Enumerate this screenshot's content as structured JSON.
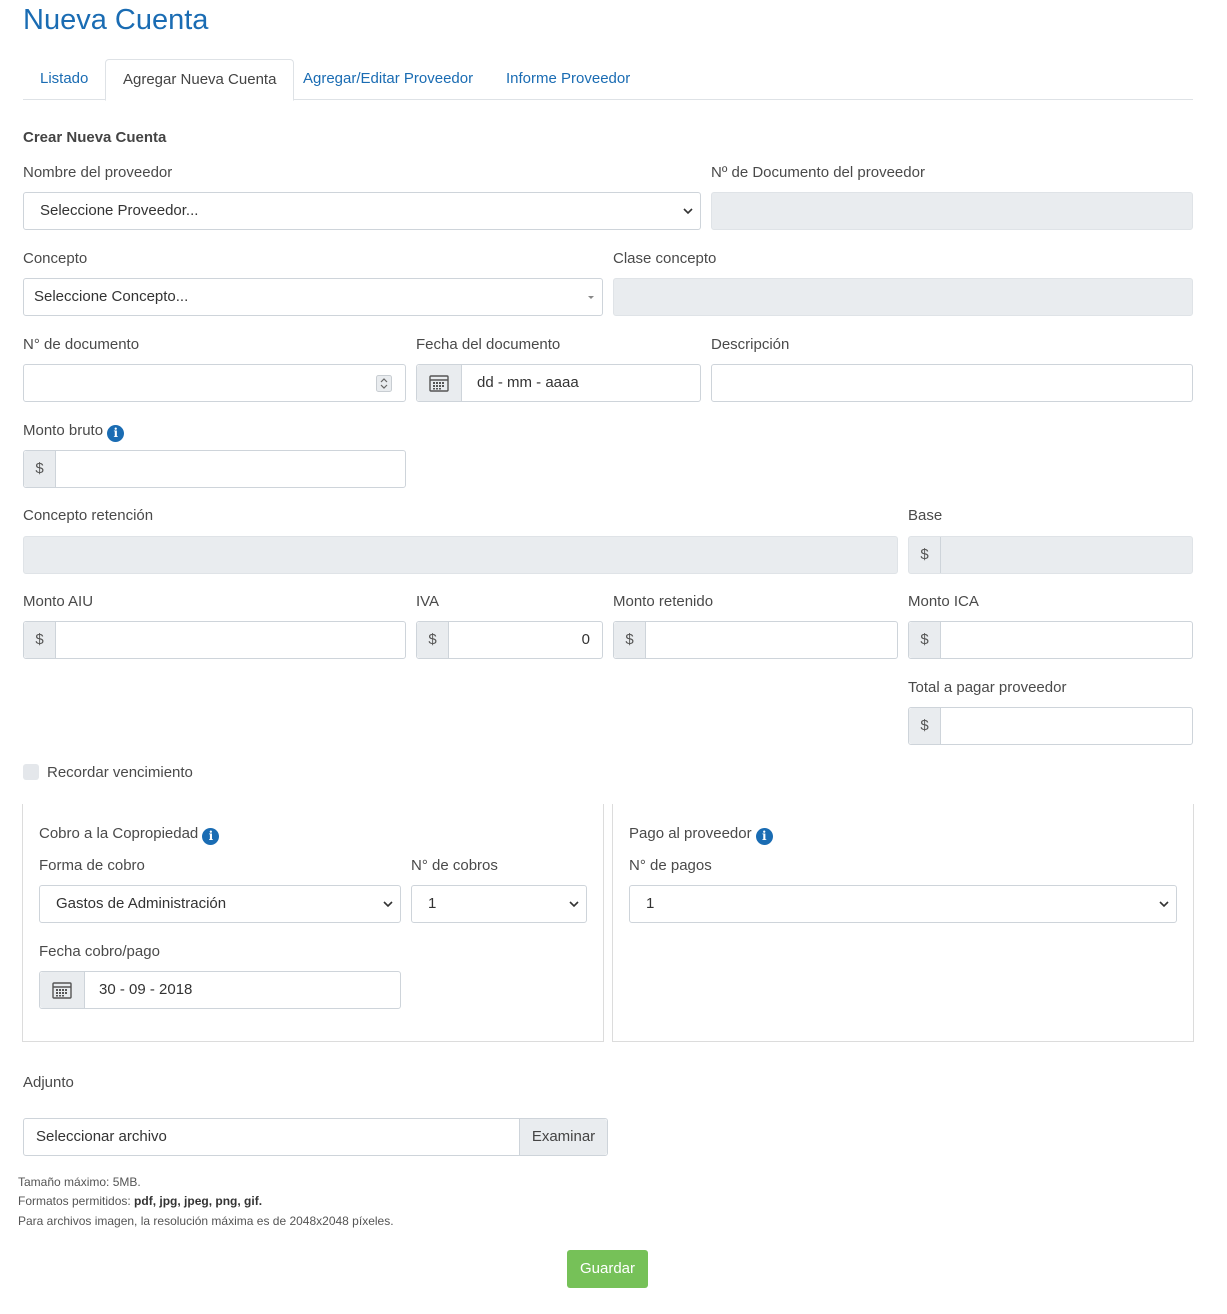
{
  "page": {
    "title": "Nueva Cuenta"
  },
  "tabs": [
    {
      "label": "Listado"
    },
    {
      "label": "Agregar Nueva Cuenta"
    },
    {
      "label": "Agregar/Editar Proveedor"
    },
    {
      "label": "Informe Proveedor"
    }
  ],
  "form": {
    "section_title": "Crear Nueva Cuenta",
    "proveedor": {
      "label": "Nombre del proveedor",
      "value": "Seleccione Proveedor..."
    },
    "doc_proveedor": {
      "label": "Nº de Documento del proveedor",
      "value": ""
    },
    "concepto": {
      "label": "Concepto",
      "value": "Seleccione Concepto..."
    },
    "clase_concepto": {
      "label": "Clase concepto",
      "value": ""
    },
    "num_documento": {
      "label": "N° de documento",
      "value": ""
    },
    "fecha_documento": {
      "label": "Fecha del documento",
      "placeholder": "dd - mm - aaaa"
    },
    "descripcion": {
      "label": "Descripción",
      "value": ""
    },
    "monto_bruto": {
      "label": "Monto bruto",
      "currency": "$",
      "value": ""
    },
    "concepto_retencion": {
      "label": "Concepto retención",
      "value": ""
    },
    "base": {
      "label": "Base",
      "currency": "$",
      "value": ""
    },
    "monto_aiu": {
      "label": "Monto AIU",
      "currency": "$",
      "value": ""
    },
    "iva": {
      "label": "IVA",
      "currency": "$",
      "value": "0"
    },
    "monto_retenido": {
      "label": "Monto retenido",
      "currency": "$",
      "value": ""
    },
    "monto_ica": {
      "label": "Monto ICA",
      "currency": "$",
      "value": ""
    },
    "total_pagar": {
      "label": "Total a pagar proveedor",
      "currency": "$",
      "value": ""
    },
    "recordar": {
      "label": "Recordar vencimiento",
      "checked": false
    }
  },
  "cobro": {
    "title": "Cobro a la Copropiedad",
    "forma_label": "Forma de cobro",
    "forma_value": "Gastos de Administración",
    "num_cobros_label": "N° de cobros",
    "num_cobros_value": "1",
    "fecha_label": "Fecha cobro/pago",
    "fecha_value": "30 - 09 - 2018"
  },
  "pago": {
    "title": "Pago al proveedor",
    "num_pagos_label": "N° de pagos",
    "num_pagos_value": "1"
  },
  "adjunto": {
    "label": "Adjunto",
    "placeholder": "Seleccionar archivo",
    "browse": "Examinar",
    "note_size": "Tamaño máximo: 5MB.",
    "note_formats_prefix": "Formatos permitidos: ",
    "note_formats": "pdf, jpg, jpeg, png, gif.",
    "note_resolution": "Para archivos imagen, la resolución máxima es de 2048x2048 píxeles."
  },
  "actions": {
    "save": "Guardar"
  },
  "colors": {
    "accent": "#1a6cb3",
    "save": "#76c158",
    "disabled": "#e9ecef"
  },
  "icons": {
    "info": "info-icon",
    "calendar": "calendar-icon",
    "chevron": "chevron-down-icon",
    "spinner": "spinner-icon"
  }
}
